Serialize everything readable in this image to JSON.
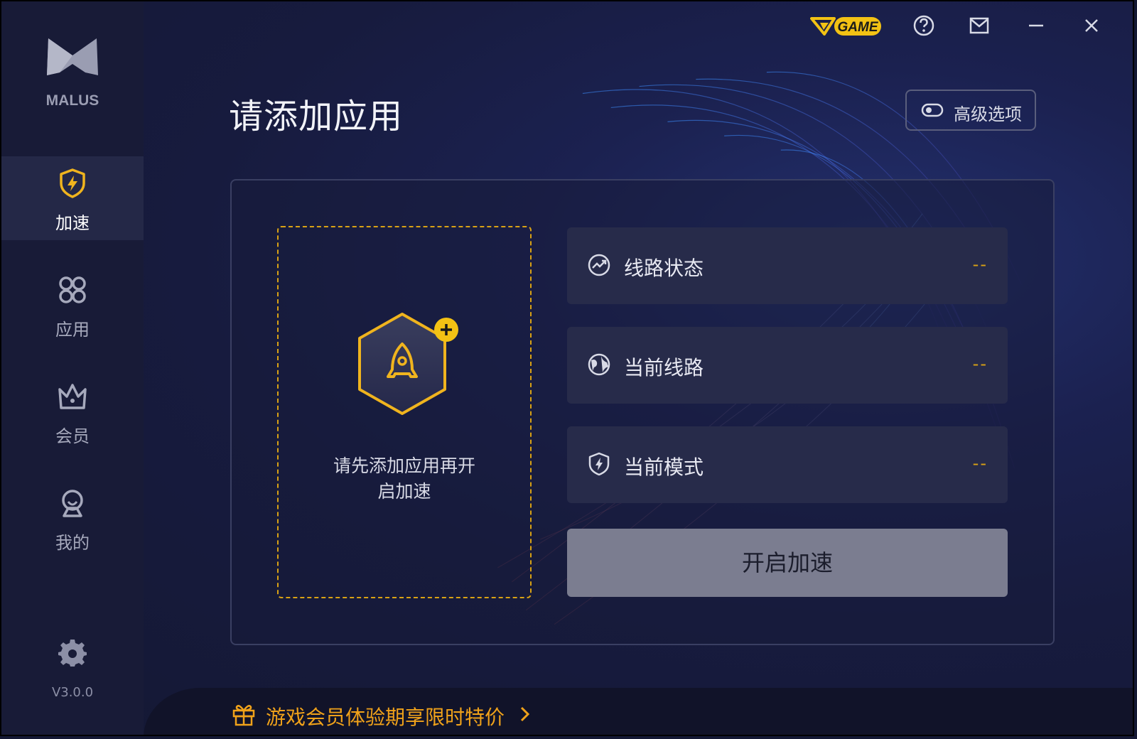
{
  "app": {
    "logo_text": "MALUS",
    "version": "V3.0.0"
  },
  "sidebar": {
    "items": [
      {
        "label": "加速",
        "icon": "shield-bolt-icon",
        "active": true
      },
      {
        "label": "应用",
        "icon": "apps-grid-icon",
        "active": false
      },
      {
        "label": "会员",
        "icon": "crown-icon",
        "active": false
      },
      {
        "label": "我的",
        "icon": "user-icon",
        "active": false
      }
    ],
    "settings_icon": "gear-icon"
  },
  "topbar": {
    "badge_text": "GAME",
    "icons": [
      "help-icon",
      "mail-icon",
      "minimize-icon",
      "close-icon"
    ]
  },
  "main": {
    "title": "请添加应用",
    "advanced_button": "高级选项",
    "drop_zone": {
      "line1": "请先添加应用再开",
      "line2": "启加速"
    },
    "info_rows": [
      {
        "label": "线路状态",
        "value": "--",
        "icon": "trend-circle-icon"
      },
      {
        "label": "当前线路",
        "value": "--",
        "icon": "globe-icon"
      },
      {
        "label": "当前模式",
        "value": "--",
        "icon": "shield-bolt-icon"
      }
    ],
    "start_button": "开启加速"
  },
  "promo": {
    "text": "游戏会员体验期享限时特价",
    "icon": "gift-icon"
  },
  "colors": {
    "accent": "#d9a214",
    "background": "#141834",
    "sidebar": "#181b37",
    "row": "#272b4a"
  }
}
